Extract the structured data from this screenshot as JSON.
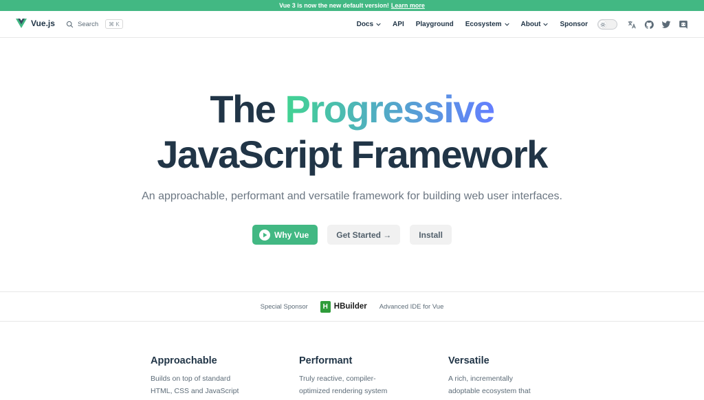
{
  "banner": {
    "text": "Vue 3 is now the new default version!",
    "link": "Learn more"
  },
  "nav": {
    "brand": "Vue.js",
    "search_label": "Search",
    "search_shortcut": "⌘ K",
    "items": [
      {
        "label": "Docs",
        "has_dropdown": true
      },
      {
        "label": "API",
        "has_dropdown": false
      },
      {
        "label": "Playground",
        "has_dropdown": false
      },
      {
        "label": "Ecosystem",
        "has_dropdown": true
      },
      {
        "label": "About",
        "has_dropdown": true
      },
      {
        "label": "Sponsor",
        "has_dropdown": false
      }
    ],
    "icons": [
      "translate-icon",
      "github-icon",
      "twitter-icon",
      "discord-icon"
    ]
  },
  "hero": {
    "title_prefix": "The",
    "title_highlight": "Progressive",
    "title_line2": "JavaScript Framework",
    "tagline": "An approachable, performant and versatile framework for building web user interfaces.",
    "buttons": {
      "primary": "Why Vue",
      "get_started": "Get Started →",
      "install": "Install"
    }
  },
  "sponsor": {
    "label": "Special Sponsor",
    "brand": "HBuilder",
    "tagline": "Advanced IDE for Vue"
  },
  "features": [
    {
      "title": "Approachable",
      "desc1": "Builds on top of standard",
      "desc2": "HTML, CSS and JavaScript"
    },
    {
      "title": "Performant",
      "desc1": "Truly reactive, compiler-",
      "desc2": "optimized rendering system"
    },
    {
      "title": "Versatile",
      "desc1": "A rich, incrementally",
      "desc2": "adoptable ecosystem that"
    }
  ],
  "colors": {
    "brand": "#42b883",
    "text": "#213547",
    "gradient_start": "#42d392",
    "gradient_end": "#647eff"
  }
}
